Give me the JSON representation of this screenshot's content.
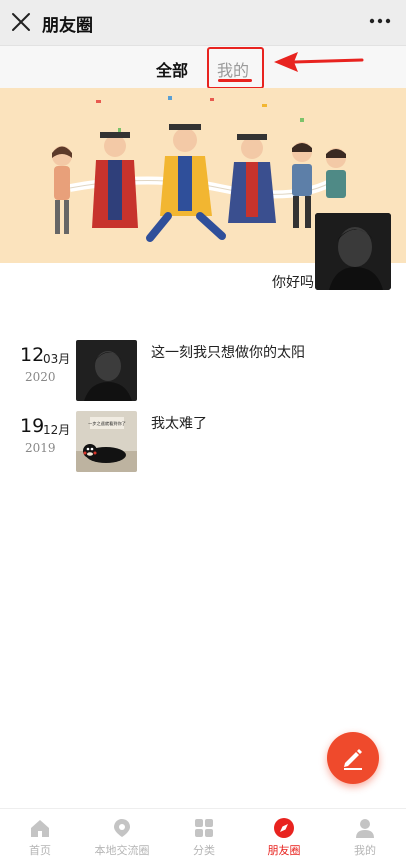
{
  "header": {
    "title": "朋友圈",
    "close_icon": "close-icon",
    "more_icon": "more-icon"
  },
  "tabs": {
    "all": "全部",
    "mine": "我的",
    "active": "mine",
    "highlight_color": "#e8231f"
  },
  "profile": {
    "nickname": "你好吗"
  },
  "posts": [
    {
      "day": "12",
      "month": "03月",
      "year": "2020",
      "text": "这一刻我只想做你的太阳",
      "thumb": "portrait-photo"
    },
    {
      "day": "19",
      "month": "12月",
      "year": "2019",
      "text": "我太难了",
      "thumb": "kumamon-meme",
      "thumb_caption": "一步之遥就看到你了"
    }
  ],
  "fab": {
    "icon": "edit-pen-icon",
    "color": "#ef4a2c"
  },
  "bottom_nav": [
    {
      "label": "首页",
      "icon": "home-icon",
      "active": false
    },
    {
      "label": "本地交流圈",
      "icon": "location-icon",
      "active": false
    },
    {
      "label": "分类",
      "icon": "grid-icon",
      "active": false
    },
    {
      "label": "朋友圈",
      "icon": "compass-icon",
      "active": true
    },
    {
      "label": "我的",
      "icon": "user-icon",
      "active": false
    }
  ]
}
